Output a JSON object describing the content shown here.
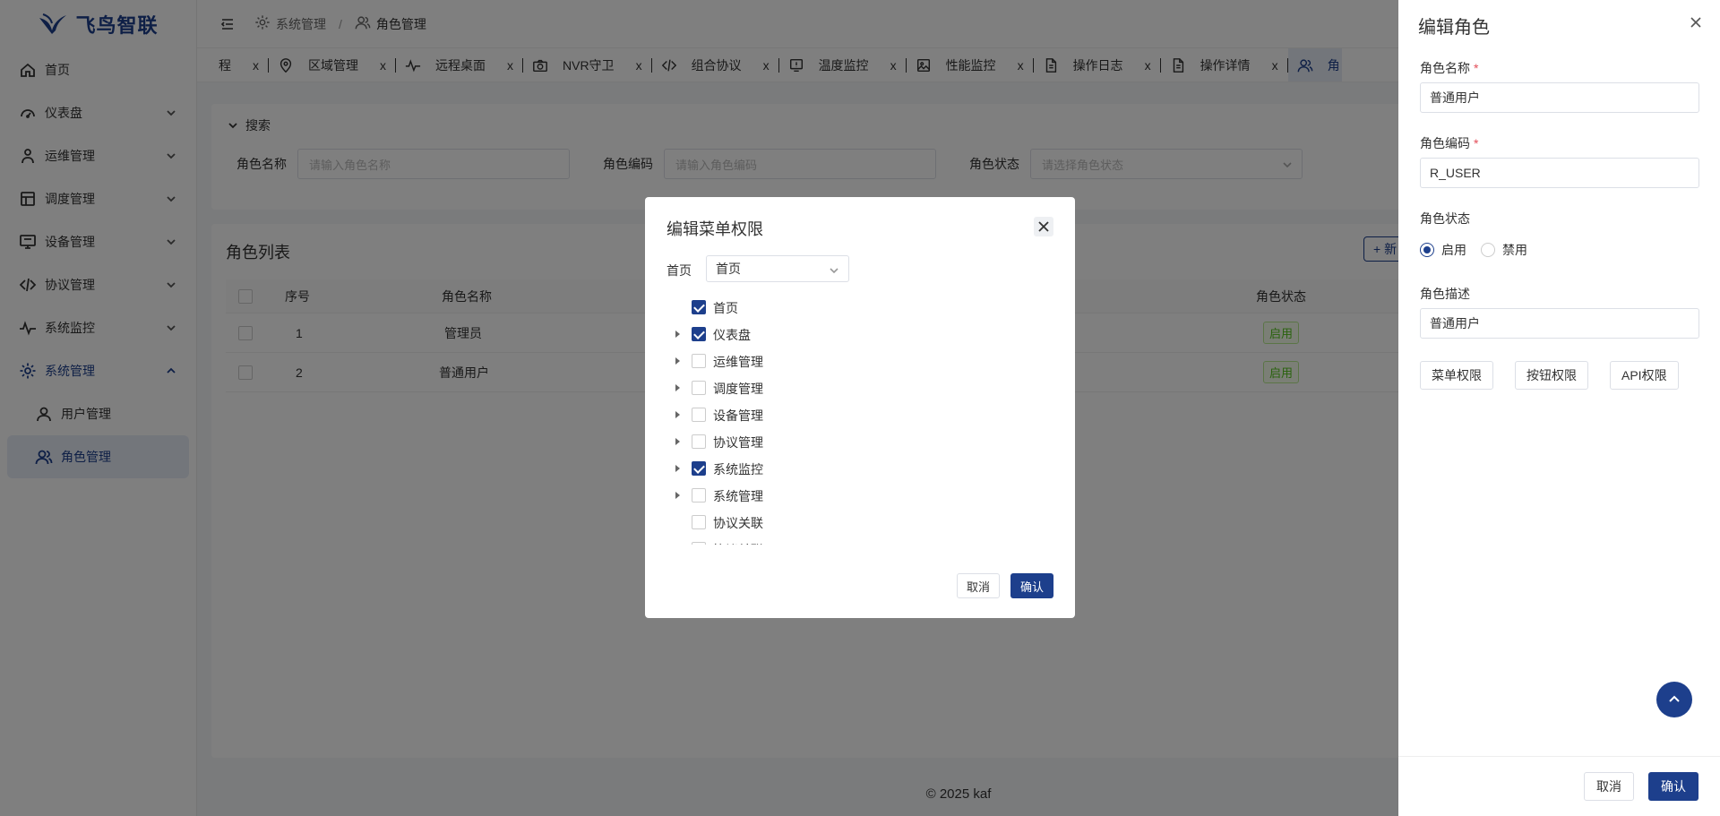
{
  "app": {
    "logo_text": "飞鸟智联",
    "brand_color": "#1d3f8c"
  },
  "sidebar": {
    "items": [
      {
        "label": "首页",
        "icon": "home-icon",
        "expandable": false
      },
      {
        "label": "仪表盘",
        "icon": "dashboard-icon",
        "expandable": true
      },
      {
        "label": "运维管理",
        "icon": "operator-icon",
        "expandable": true
      },
      {
        "label": "调度管理",
        "icon": "schedule-icon",
        "expandable": true
      },
      {
        "label": "设备管理",
        "icon": "device-icon",
        "expandable": true
      },
      {
        "label": "协议管理",
        "icon": "code-icon",
        "expandable": true
      },
      {
        "label": "系统监控",
        "icon": "pulse-icon",
        "expandable": true
      },
      {
        "label": "系统管理",
        "icon": "gear-icon",
        "expandable": true,
        "expanded": true
      },
      {
        "label": "用户管理",
        "icon": "user-icon",
        "sub": true
      },
      {
        "label": "角色管理",
        "icon": "users-icon",
        "sub": true,
        "selected": true
      }
    ]
  },
  "header": {
    "breadcrumb": [
      {
        "label": "系统管理",
        "icon": "gear-icon"
      },
      {
        "label": "角色管理",
        "icon": "users-icon"
      }
    ],
    "breadcrumb_sep": "/"
  },
  "tabs": [
    {
      "label": "程",
      "icon": ""
    },
    {
      "label": "区域管理",
      "icon": "location-icon"
    },
    {
      "label": "远程桌面",
      "icon": "pulse-icon"
    },
    {
      "label": "NVR守卫",
      "icon": "camera-icon"
    },
    {
      "label": "组合协议",
      "icon": "code-icon"
    },
    {
      "label": "温度监控",
      "icon": "monitor-icon"
    },
    {
      "label": "性能监控",
      "icon": "image-icon"
    },
    {
      "label": "操作日志",
      "icon": "document-icon"
    },
    {
      "label": "操作详情",
      "icon": "document-icon"
    },
    {
      "label": "角",
      "icon": "users-icon",
      "active": true
    }
  ],
  "tab_close": "x",
  "search": {
    "title": "搜索",
    "fields": [
      {
        "label": "角色名称",
        "placeholder": "请输入角色名称"
      },
      {
        "label": "角色编码",
        "placeholder": "请输入角色编码"
      },
      {
        "label": "角色状态",
        "placeholder": "请选择角色状态"
      }
    ]
  },
  "list": {
    "title": "角色列表",
    "add_button": "+ 新",
    "columns": [
      "序号",
      "角色名称",
      "角色状态"
    ],
    "rows": [
      {
        "index": "1",
        "name": "管理员",
        "status": "启用"
      },
      {
        "index": "2",
        "name": "普通用户",
        "status": "启用"
      }
    ]
  },
  "footer": "© 2025 kaf",
  "drawer": {
    "title": "编辑角色",
    "name_label": "角色名称",
    "name_value": "普通用户",
    "code_label": "角色编码",
    "code_value": "R_USER",
    "required_mark": "*",
    "status_label": "角色状态",
    "status_options": [
      "启用",
      "禁用"
    ],
    "status_selected": "启用",
    "desc_label": "角色描述",
    "desc_value": "普通用户",
    "perm_buttons": [
      "菜单权限",
      "按钮权限",
      "API权限"
    ],
    "cancel": "取消",
    "confirm": "确认"
  },
  "modal": {
    "title": "编辑菜单权限",
    "select_label": "首页",
    "select_value": "首页",
    "tree": [
      {
        "label": "首页",
        "checked": true,
        "expandable": false
      },
      {
        "label": "仪表盘",
        "checked": true,
        "expandable": true
      },
      {
        "label": "运维管理",
        "checked": false,
        "expandable": true
      },
      {
        "label": "调度管理",
        "checked": false,
        "expandable": true
      },
      {
        "label": "设备管理",
        "checked": false,
        "expandable": true
      },
      {
        "label": "协议管理",
        "checked": false,
        "expandable": true
      },
      {
        "label": "系统监控",
        "checked": true,
        "expandable": true
      },
      {
        "label": "系统管理",
        "checked": false,
        "expandable": true
      },
      {
        "label": "协议关联",
        "checked": false,
        "expandable": false
      },
      {
        "label": "协议关联",
        "checked": false,
        "expandable": false
      }
    ],
    "cancel": "取消",
    "confirm": "确认"
  }
}
